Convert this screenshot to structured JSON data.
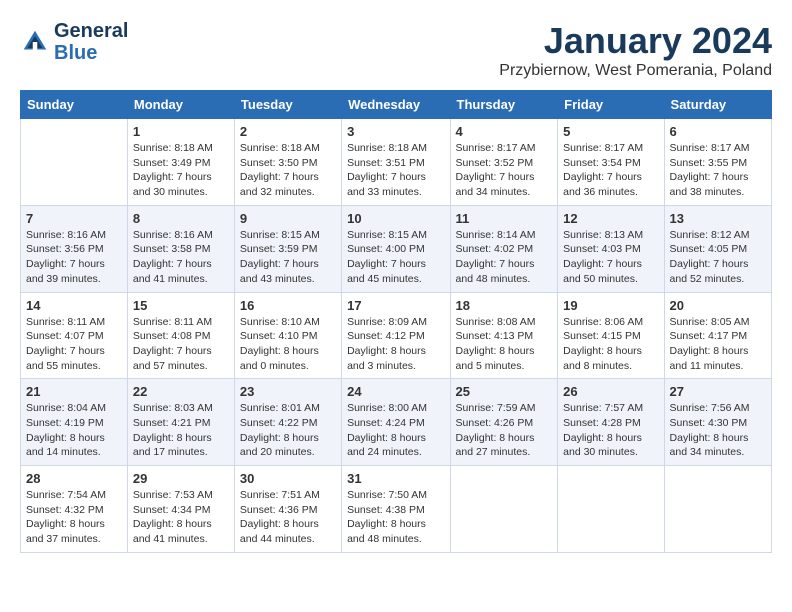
{
  "logo": {
    "line1": "General",
    "line2": "Blue"
  },
  "title": "January 2024",
  "subtitle": "Przybiernow, West Pomerania, Poland",
  "days_header": [
    "Sunday",
    "Monday",
    "Tuesday",
    "Wednesday",
    "Thursday",
    "Friday",
    "Saturday"
  ],
  "weeks": [
    [
      {
        "day": "",
        "sunrise": "",
        "sunset": "",
        "daylight": ""
      },
      {
        "day": "1",
        "sunrise": "Sunrise: 8:18 AM",
        "sunset": "Sunset: 3:49 PM",
        "daylight": "Daylight: 7 hours and 30 minutes."
      },
      {
        "day": "2",
        "sunrise": "Sunrise: 8:18 AM",
        "sunset": "Sunset: 3:50 PM",
        "daylight": "Daylight: 7 hours and 32 minutes."
      },
      {
        "day": "3",
        "sunrise": "Sunrise: 8:18 AM",
        "sunset": "Sunset: 3:51 PM",
        "daylight": "Daylight: 7 hours and 33 minutes."
      },
      {
        "day": "4",
        "sunrise": "Sunrise: 8:17 AM",
        "sunset": "Sunset: 3:52 PM",
        "daylight": "Daylight: 7 hours and 34 minutes."
      },
      {
        "day": "5",
        "sunrise": "Sunrise: 8:17 AM",
        "sunset": "Sunset: 3:54 PM",
        "daylight": "Daylight: 7 hours and 36 minutes."
      },
      {
        "day": "6",
        "sunrise": "Sunrise: 8:17 AM",
        "sunset": "Sunset: 3:55 PM",
        "daylight": "Daylight: 7 hours and 38 minutes."
      }
    ],
    [
      {
        "day": "7",
        "sunrise": "Sunrise: 8:16 AM",
        "sunset": "Sunset: 3:56 PM",
        "daylight": "Daylight: 7 hours and 39 minutes."
      },
      {
        "day": "8",
        "sunrise": "Sunrise: 8:16 AM",
        "sunset": "Sunset: 3:58 PM",
        "daylight": "Daylight: 7 hours and 41 minutes."
      },
      {
        "day": "9",
        "sunrise": "Sunrise: 8:15 AM",
        "sunset": "Sunset: 3:59 PM",
        "daylight": "Daylight: 7 hours and 43 minutes."
      },
      {
        "day": "10",
        "sunrise": "Sunrise: 8:15 AM",
        "sunset": "Sunset: 4:00 PM",
        "daylight": "Daylight: 7 hours and 45 minutes."
      },
      {
        "day": "11",
        "sunrise": "Sunrise: 8:14 AM",
        "sunset": "Sunset: 4:02 PM",
        "daylight": "Daylight: 7 hours and 48 minutes."
      },
      {
        "day": "12",
        "sunrise": "Sunrise: 8:13 AM",
        "sunset": "Sunset: 4:03 PM",
        "daylight": "Daylight: 7 hours and 50 minutes."
      },
      {
        "day": "13",
        "sunrise": "Sunrise: 8:12 AM",
        "sunset": "Sunset: 4:05 PM",
        "daylight": "Daylight: 7 hours and 52 minutes."
      }
    ],
    [
      {
        "day": "14",
        "sunrise": "Sunrise: 8:11 AM",
        "sunset": "Sunset: 4:07 PM",
        "daylight": "Daylight: 7 hours and 55 minutes."
      },
      {
        "day": "15",
        "sunrise": "Sunrise: 8:11 AM",
        "sunset": "Sunset: 4:08 PM",
        "daylight": "Daylight: 7 hours and 57 minutes."
      },
      {
        "day": "16",
        "sunrise": "Sunrise: 8:10 AM",
        "sunset": "Sunset: 4:10 PM",
        "daylight": "Daylight: 8 hours and 0 minutes."
      },
      {
        "day": "17",
        "sunrise": "Sunrise: 8:09 AM",
        "sunset": "Sunset: 4:12 PM",
        "daylight": "Daylight: 8 hours and 3 minutes."
      },
      {
        "day": "18",
        "sunrise": "Sunrise: 8:08 AM",
        "sunset": "Sunset: 4:13 PM",
        "daylight": "Daylight: 8 hours and 5 minutes."
      },
      {
        "day": "19",
        "sunrise": "Sunrise: 8:06 AM",
        "sunset": "Sunset: 4:15 PM",
        "daylight": "Daylight: 8 hours and 8 minutes."
      },
      {
        "day": "20",
        "sunrise": "Sunrise: 8:05 AM",
        "sunset": "Sunset: 4:17 PM",
        "daylight": "Daylight: 8 hours and 11 minutes."
      }
    ],
    [
      {
        "day": "21",
        "sunrise": "Sunrise: 8:04 AM",
        "sunset": "Sunset: 4:19 PM",
        "daylight": "Daylight: 8 hours and 14 minutes."
      },
      {
        "day": "22",
        "sunrise": "Sunrise: 8:03 AM",
        "sunset": "Sunset: 4:21 PM",
        "daylight": "Daylight: 8 hours and 17 minutes."
      },
      {
        "day": "23",
        "sunrise": "Sunrise: 8:01 AM",
        "sunset": "Sunset: 4:22 PM",
        "daylight": "Daylight: 8 hours and 20 minutes."
      },
      {
        "day": "24",
        "sunrise": "Sunrise: 8:00 AM",
        "sunset": "Sunset: 4:24 PM",
        "daylight": "Daylight: 8 hours and 24 minutes."
      },
      {
        "day": "25",
        "sunrise": "Sunrise: 7:59 AM",
        "sunset": "Sunset: 4:26 PM",
        "daylight": "Daylight: 8 hours and 27 minutes."
      },
      {
        "day": "26",
        "sunrise": "Sunrise: 7:57 AM",
        "sunset": "Sunset: 4:28 PM",
        "daylight": "Daylight: 8 hours and 30 minutes."
      },
      {
        "day": "27",
        "sunrise": "Sunrise: 7:56 AM",
        "sunset": "Sunset: 4:30 PM",
        "daylight": "Daylight: 8 hours and 34 minutes."
      }
    ],
    [
      {
        "day": "28",
        "sunrise": "Sunrise: 7:54 AM",
        "sunset": "Sunset: 4:32 PM",
        "daylight": "Daylight: 8 hours and 37 minutes."
      },
      {
        "day": "29",
        "sunrise": "Sunrise: 7:53 AM",
        "sunset": "Sunset: 4:34 PM",
        "daylight": "Daylight: 8 hours and 41 minutes."
      },
      {
        "day": "30",
        "sunrise": "Sunrise: 7:51 AM",
        "sunset": "Sunset: 4:36 PM",
        "daylight": "Daylight: 8 hours and 44 minutes."
      },
      {
        "day": "31",
        "sunrise": "Sunrise: 7:50 AM",
        "sunset": "Sunset: 4:38 PM",
        "daylight": "Daylight: 8 hours and 48 minutes."
      },
      {
        "day": "",
        "sunrise": "",
        "sunset": "",
        "daylight": ""
      },
      {
        "day": "",
        "sunrise": "",
        "sunset": "",
        "daylight": ""
      },
      {
        "day": "",
        "sunrise": "",
        "sunset": "",
        "daylight": ""
      }
    ]
  ]
}
